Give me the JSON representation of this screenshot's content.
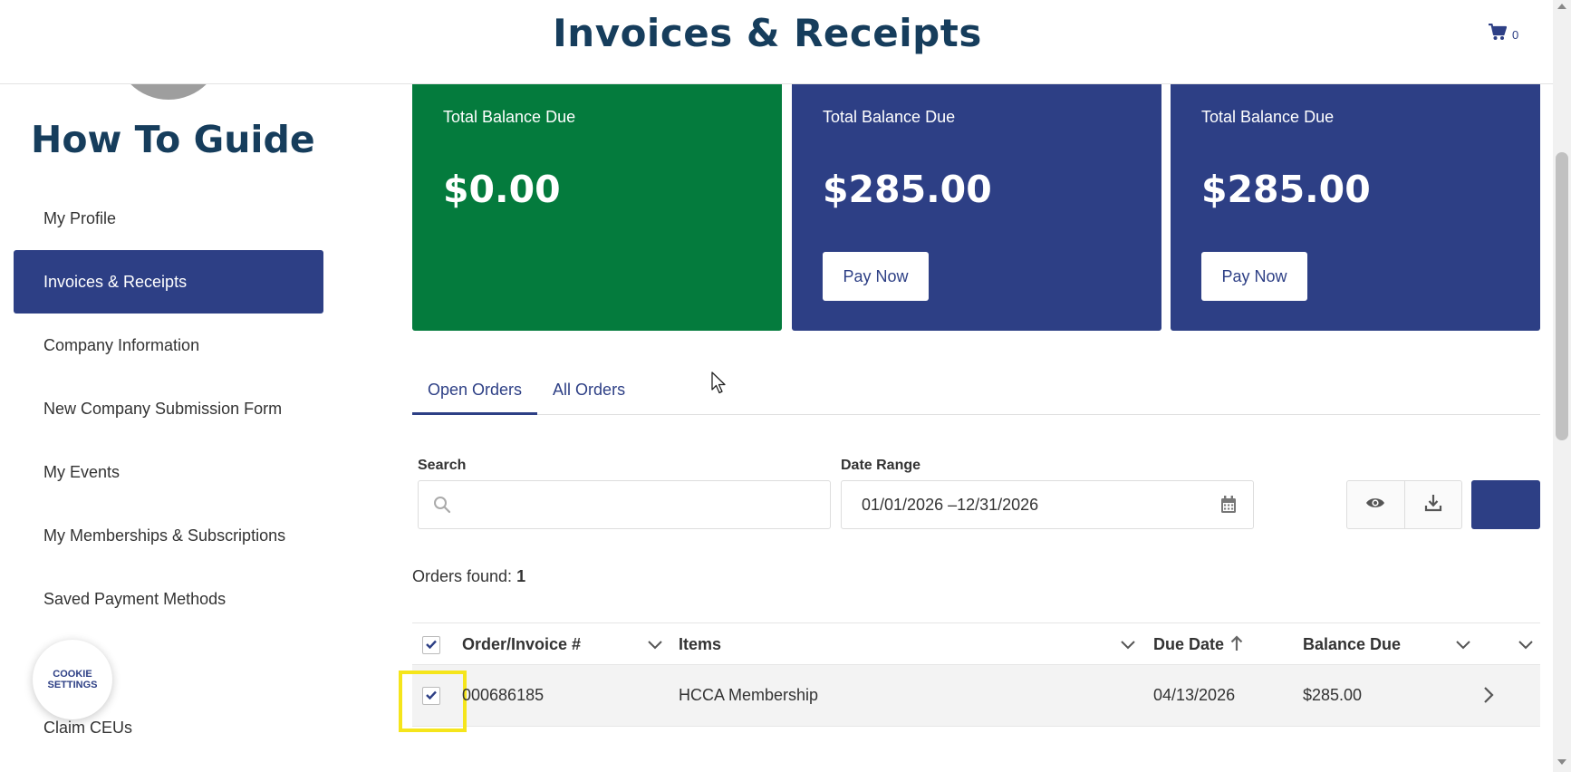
{
  "header": {
    "title": "Invoices & Receipts",
    "cart_icon": "cart-icon",
    "cart_count": "0"
  },
  "sidebar": {
    "title": "How To Guide",
    "items": [
      {
        "label": "My Profile",
        "active": false
      },
      {
        "label": "Invoices & Receipts",
        "active": true
      },
      {
        "label": "Company Information",
        "active": false
      },
      {
        "label": "New Company Submission Form",
        "active": false
      },
      {
        "label": "My Events",
        "active": false
      },
      {
        "label": "My Memberships & Subscriptions",
        "active": false
      },
      {
        "label": "Saved Payment Methods",
        "active": false
      },
      {
        "label": "Claim CEUs",
        "active": false
      }
    ],
    "cookie_line1": "COOKIE",
    "cookie_line2": "SETTINGS"
  },
  "cards": [
    {
      "label": "Total Balance Due",
      "amount": "$0.00",
      "color": "#047b3d"
    },
    {
      "label": "Total Balance Due",
      "amount": "$285.00",
      "button": "Pay Now",
      "color": "#2d3f85"
    },
    {
      "label": "Total Balance Due",
      "amount": "$285.00",
      "button": "Pay Now",
      "color": "#2d3f85"
    }
  ],
  "tabs": [
    {
      "label": "Open Orders",
      "active": true
    },
    {
      "label": "All Orders",
      "active": false
    }
  ],
  "filters": {
    "search_label": "Search",
    "search_value": "",
    "date_label": "Date Range",
    "date_value": "01/01/2026 –12/31/2026"
  },
  "orders_found": {
    "label": "Orders found:",
    "count": "1"
  },
  "table": {
    "columns": [
      "Order/Invoice #",
      "Items",
      "Due Date",
      "Balance Due"
    ],
    "rows": [
      {
        "order": "000686185",
        "items": "HCCA Membership",
        "due_date": "04/13/2026",
        "balance": "$285.00",
        "checked": true
      }
    ]
  },
  "colors": {
    "primary": "#2d3f85",
    "success": "#047b3d",
    "heading": "#163d5c",
    "highlight": "#f5e51b"
  }
}
